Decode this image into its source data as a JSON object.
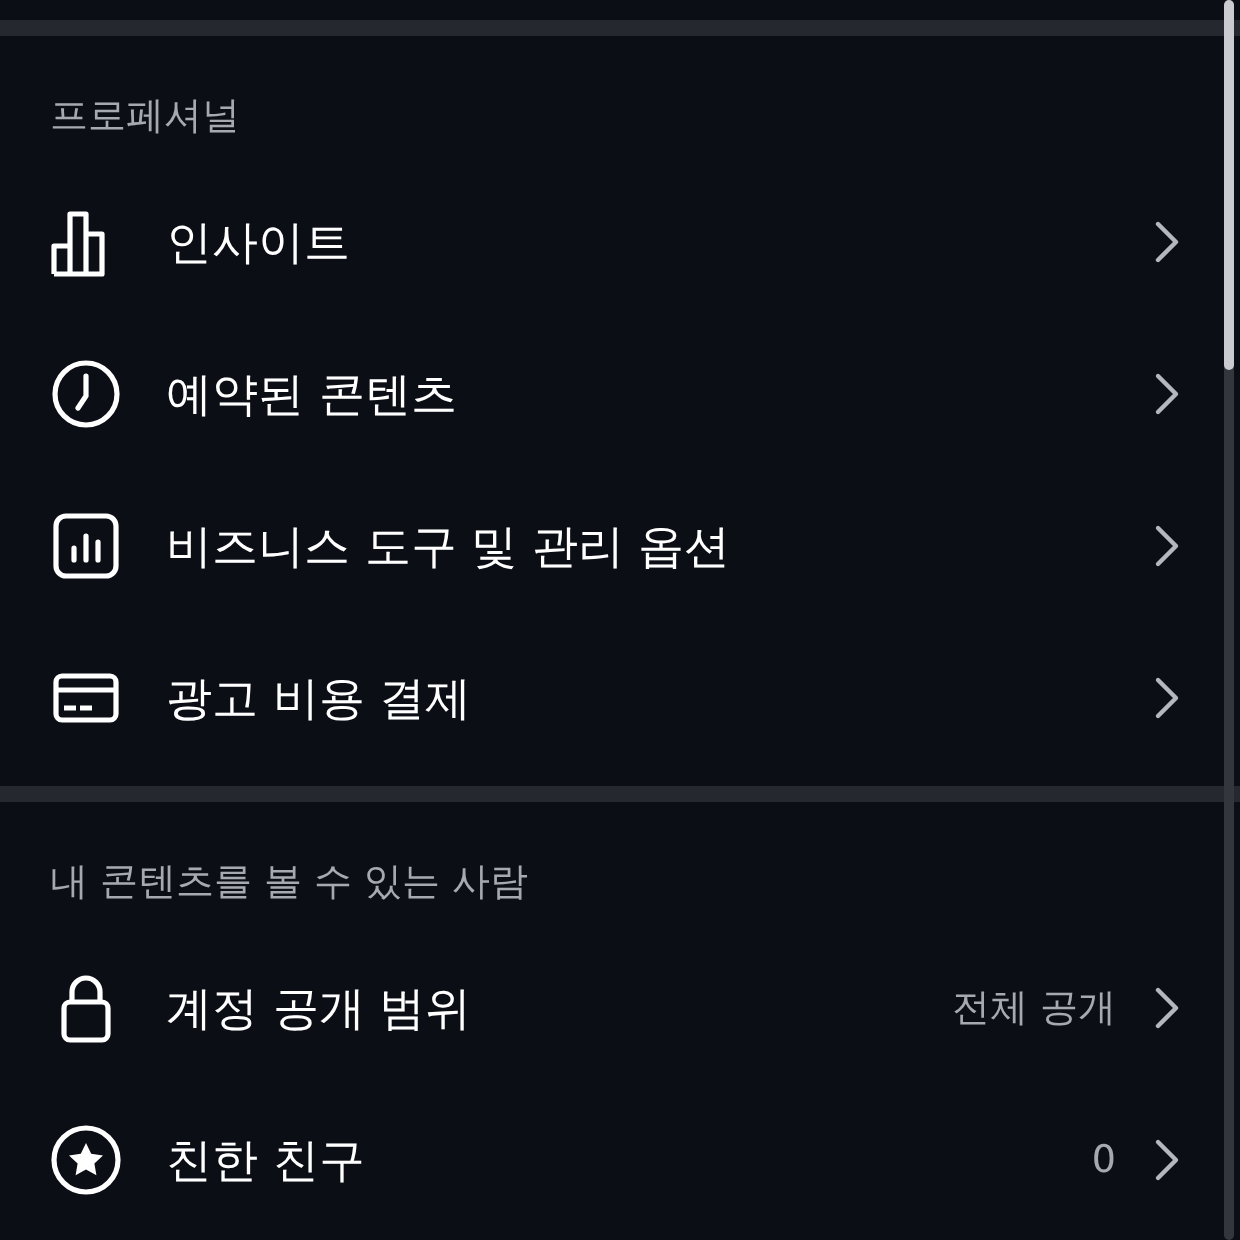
{
  "sections": [
    {
      "header": "프로페셔널",
      "items": [
        {
          "label": "인사이트"
        },
        {
          "label": "예약된 콘텐츠"
        },
        {
          "label": "비즈니스 도구 및 관리 옵션"
        },
        {
          "label": "광고 비용 결제"
        }
      ]
    },
    {
      "header": "내 콘텐츠를 볼 수 있는 사람",
      "items": [
        {
          "label": "계정 공개 범위",
          "value": "전체 공개"
        },
        {
          "label": "친한 친구",
          "value": "0"
        }
      ]
    }
  ]
}
